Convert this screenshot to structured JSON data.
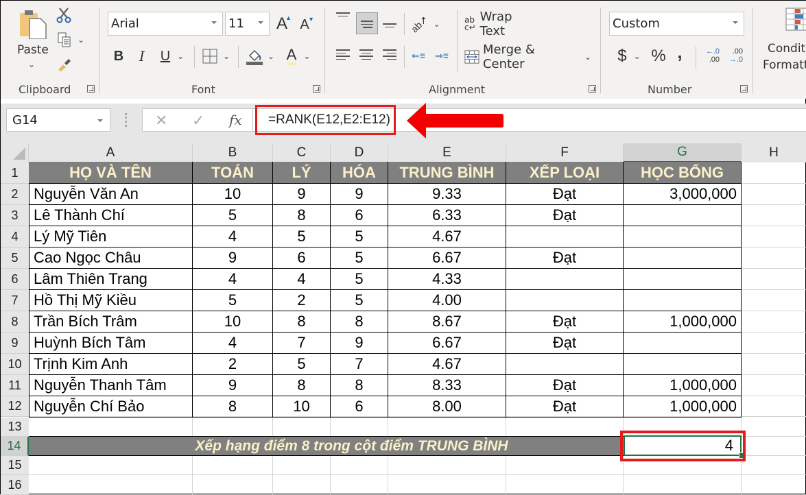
{
  "ribbon": {
    "clipboard": {
      "label": "Clipboard",
      "paste_label": "Paste"
    },
    "font": {
      "label": "Font",
      "font_name": "Arial",
      "font_size": "11",
      "bold": "B",
      "italic": "I",
      "underline": "U",
      "grow": "A",
      "shrink": "A",
      "font_color": "A"
    },
    "alignment": {
      "label": "Alignment",
      "wrap_text": "Wrap Text",
      "merge_center": "Merge & Center"
    },
    "number": {
      "label": "Number",
      "format": "Custom",
      "currency": "$",
      "percent": "%",
      "comma": ",",
      "inc_decimal_top": "←.0",
      "inc_decimal_bottom": ".00",
      "dec_decimal_top": ".00",
      "dec_decimal_bottom": "→.0"
    },
    "styles": {
      "conditional_line1": "Conditi",
      "conditional_line2": "Formatt"
    }
  },
  "formula_bar": {
    "name_box": "G14",
    "cancel": "✕",
    "enter": "✓",
    "fx": "fx",
    "formula": "=RANK(E12,E2:E12)"
  },
  "annotation": {
    "arrow_color": "#e31b1b"
  },
  "columns": [
    "A",
    "B",
    "C",
    "D",
    "E",
    "F",
    "G",
    "H"
  ],
  "selected_column": "G",
  "selected_row": "14",
  "row_numbers": [
    "1",
    "2",
    "3",
    "4",
    "5",
    "6",
    "7",
    "8",
    "9",
    "10",
    "11",
    "12",
    "13",
    "14",
    "15",
    "16"
  ],
  "table": {
    "headers": [
      "HỌ VÀ TÊN",
      "TOÁN",
      "LÝ",
      "HÓA",
      "TRUNG BÌNH",
      "XẾP LOẠI",
      "HỌC BỔNG"
    ],
    "rows": [
      [
        "Nguyễn Văn An",
        "10",
        "9",
        "9",
        "9.33",
        "Đạt",
        "3,000,000"
      ],
      [
        "Lê Thành Chí",
        "5",
        "8",
        "6",
        "6.33",
        "Đạt",
        ""
      ],
      [
        "Lý Mỹ Tiên",
        "4",
        "5",
        "5",
        "4.67",
        "",
        ""
      ],
      [
        "Cao Ngọc Châu",
        "9",
        "6",
        "5",
        "6.67",
        "Đạt",
        ""
      ],
      [
        "Lâm Thiên Trang",
        "4",
        "4",
        "5",
        "4.33",
        "",
        ""
      ],
      [
        "Hồ Thị Mỹ Kiều",
        "5",
        "2",
        "5",
        "4.00",
        "",
        ""
      ],
      [
        "Trần Bích Trâm",
        "10",
        "8",
        "8",
        "8.67",
        "Đạt",
        "1,000,000"
      ],
      [
        "Huỳnh Bích Tâm",
        "4",
        "7",
        "9",
        "6.67",
        "Đạt",
        ""
      ],
      [
        "Trịnh Kim Anh",
        "2",
        "5",
        "7",
        "4.67",
        "",
        ""
      ],
      [
        "Nguyễn Thanh Tâm",
        "9",
        "8",
        "8",
        "8.33",
        "Đạt",
        "1,000,000"
      ],
      [
        "Nguyễn Chí Bảo",
        "8",
        "10",
        "6",
        "8.00",
        "Đạt",
        "1,000,000"
      ]
    ]
  },
  "summary": {
    "label": "Xếp hạng điểm 8 trong cột điểm TRUNG BÌNH",
    "result": "4"
  },
  "colors": {
    "header_bg": "#808080",
    "header_text": "#fbf0c8",
    "selection": "#217346",
    "highlight": "#e31b1b"
  }
}
